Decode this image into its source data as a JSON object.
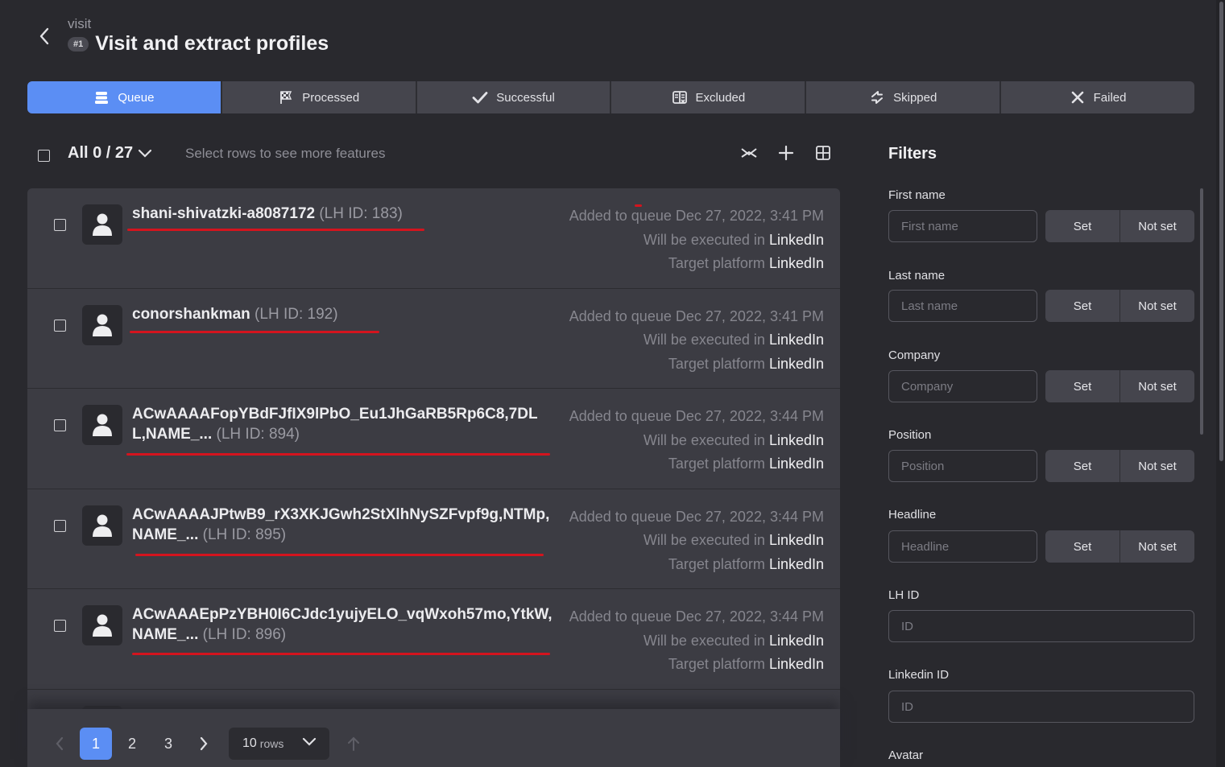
{
  "header": {
    "back_icon": "chevron-left-icon",
    "kicker": "visit",
    "step_badge": "#1",
    "title": "Visit and extract profiles"
  },
  "tabs": [
    {
      "label": "Queue",
      "icon": "stack-icon",
      "active": true
    },
    {
      "label": "Processed",
      "icon": "flag-icon"
    },
    {
      "label": "Successful",
      "icon": "checkmark-icon"
    },
    {
      "label": "Excluded",
      "icon": "excluded-icon"
    },
    {
      "label": "Skipped",
      "icon": "skip-arrows-icon"
    },
    {
      "label": "Failed",
      "icon": "x-icon"
    }
  ],
  "toolbar": {
    "selection": "All 0 / 27",
    "hint": "Select rows to see more features"
  },
  "rows": [
    {
      "name": "shani-shivatzki-a8087172",
      "lh_id": "(LH ID: 183)",
      "added_label": "Added to queue",
      "added_at": "Dec 27, 2022, 3:41 PM",
      "exec_label": "Will be executed in",
      "exec_platform": "LinkedIn",
      "target_label": "Target platform",
      "target_platform": "LinkedIn"
    },
    {
      "name": "conorshankman",
      "lh_id": "(LH ID: 192)",
      "added_label": "Added to queue",
      "added_at": "Dec 27, 2022, 3:41 PM",
      "exec_label": "Will be executed in",
      "exec_platform": "LinkedIn",
      "target_label": "Target platform",
      "target_platform": "LinkedIn"
    },
    {
      "name": "ACwAAAAFopYBdFJfIX9lPbO_Eu1JhGaRB5Rp6C8,7DLL,NAME_...",
      "lh_id": "(LH ID: 894)",
      "added_label": "Added to queue",
      "added_at": "Dec 27, 2022, 3:44 PM",
      "exec_label": "Will be executed in",
      "exec_platform": "LinkedIn",
      "target_label": "Target platform",
      "target_platform": "LinkedIn"
    },
    {
      "name": "ACwAAAAJPtwB9_rX3XKJGwh2StXlhNySZFvpf9g,NTMp,NAME_...",
      "lh_id": "(LH ID: 895)",
      "added_label": "Added to queue",
      "added_at": "Dec 27, 2022, 3:44 PM",
      "exec_label": "Will be executed in",
      "exec_platform": "LinkedIn",
      "target_label": "Target platform",
      "target_platform": "LinkedIn"
    },
    {
      "name": "ACwAAAEpPzYBH0I6CJdc1yujyELO_vqWxoh57mo,YtkW,NAME_...",
      "lh_id": "(LH ID: 896)",
      "added_label": "Added to queue",
      "added_at": "Dec 27, 2022, 3:44 PM",
      "exec_label": "Will be executed in",
      "exec_platform": "LinkedIn",
      "target_label": "Target platform",
      "target_platform": "LinkedIn"
    }
  ],
  "pagination": {
    "pages": [
      "1",
      "2",
      "3"
    ],
    "current": "1",
    "rows_value": "10",
    "rows_unit": "rows"
  },
  "filters": {
    "title": "Filters",
    "set_label": "Set",
    "not_set_label": "Not set",
    "fields": [
      {
        "label": "First name",
        "placeholder": "First name"
      },
      {
        "label": "Last name",
        "placeholder": "Last name"
      },
      {
        "label": "Company",
        "placeholder": "Company"
      },
      {
        "label": "Position",
        "placeholder": "Position"
      },
      {
        "label": "Headline",
        "placeholder": "Headline"
      },
      {
        "label": "LH ID",
        "placeholder": "ID"
      },
      {
        "label": "Linkedin ID",
        "placeholder": "ID"
      },
      {
        "label": "Avatar"
      }
    ]
  },
  "colors": {
    "background": "#29292e",
    "panel": "#3c3c43",
    "accent": "#5b8ef4",
    "annotation": "#d4141e"
  }
}
